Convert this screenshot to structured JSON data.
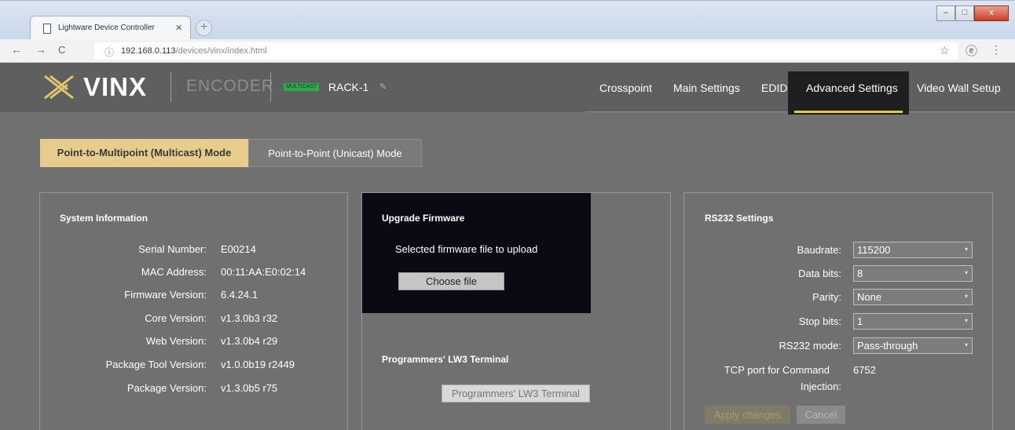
{
  "browser": {
    "tab_title": "Lightware Device Controller",
    "tab_close": "×",
    "new_tab": "+",
    "url_host": "192.168.0.113",
    "url_path": "/devices/vinx/index.html",
    "window_buttons": {
      "minimize": "–",
      "maximize": "□",
      "close": "x"
    },
    "nav": {
      "back": "←",
      "forward": "→",
      "reload": "C",
      "info": "ⓘ",
      "star": "☆",
      "account": "ⓔ",
      "menu": "⋮"
    }
  },
  "header": {
    "logo_text": "VINX",
    "product_type": "ENCODER",
    "badge": "MULTICAST",
    "device_name": "RACK-1",
    "edit_icon": "✎",
    "nav_items": [
      "Crosspoint",
      "Main Settings",
      "EDID",
      "Advanced Settings",
      "Video Wall Setup"
    ],
    "active_nav": "Advanced Settings",
    "accent_color": "#e8c84a"
  },
  "modes": {
    "multicast": "Point-to-Multipoint (Multicast) Mode",
    "unicast": "Point-to-Point (Unicast) Mode",
    "active": "multicast"
  },
  "system_information": {
    "title": "System Information",
    "rows": [
      {
        "label": "Serial Number:",
        "value": "E00214"
      },
      {
        "label": "MAC Address:",
        "value": "00:11:AA:E0:02:14"
      },
      {
        "label": "Firmware Version:",
        "value": "6.4.24.1"
      },
      {
        "label": "Core Version:",
        "value": "v1.3.0b3 r32"
      },
      {
        "label": "Web Version:",
        "value": "v1.3.0b4 r29"
      },
      {
        "label": "Package Tool Version:",
        "value": "v1.0.0b19 r2449"
      },
      {
        "label": "Package Version:",
        "value": "v1.3.0b5 r75"
      }
    ]
  },
  "firmware": {
    "title": "Upgrade Firmware",
    "text": "Selected firmware file to upload",
    "button": "Choose file"
  },
  "terminal": {
    "title": "Programmers' LW3 Terminal",
    "button": "Programmers' LW3 Terminal"
  },
  "rs232": {
    "title": "RS232 Settings",
    "fields": [
      {
        "label": "Baudrate:",
        "value": "115200"
      },
      {
        "label": "Data bits:",
        "value": "8"
      },
      {
        "label": "Parity:",
        "value": "None"
      },
      {
        "label": "Stop bits:",
        "value": "1"
      },
      {
        "label": "RS232 mode:",
        "value": "Pass-through"
      }
    ],
    "tcp_label_line1": "TCP port for Command",
    "tcp_label_line2": "Injection:",
    "tcp_value": "6752",
    "apply_button": "Apply changes",
    "cancel_button": "Cancel"
  }
}
